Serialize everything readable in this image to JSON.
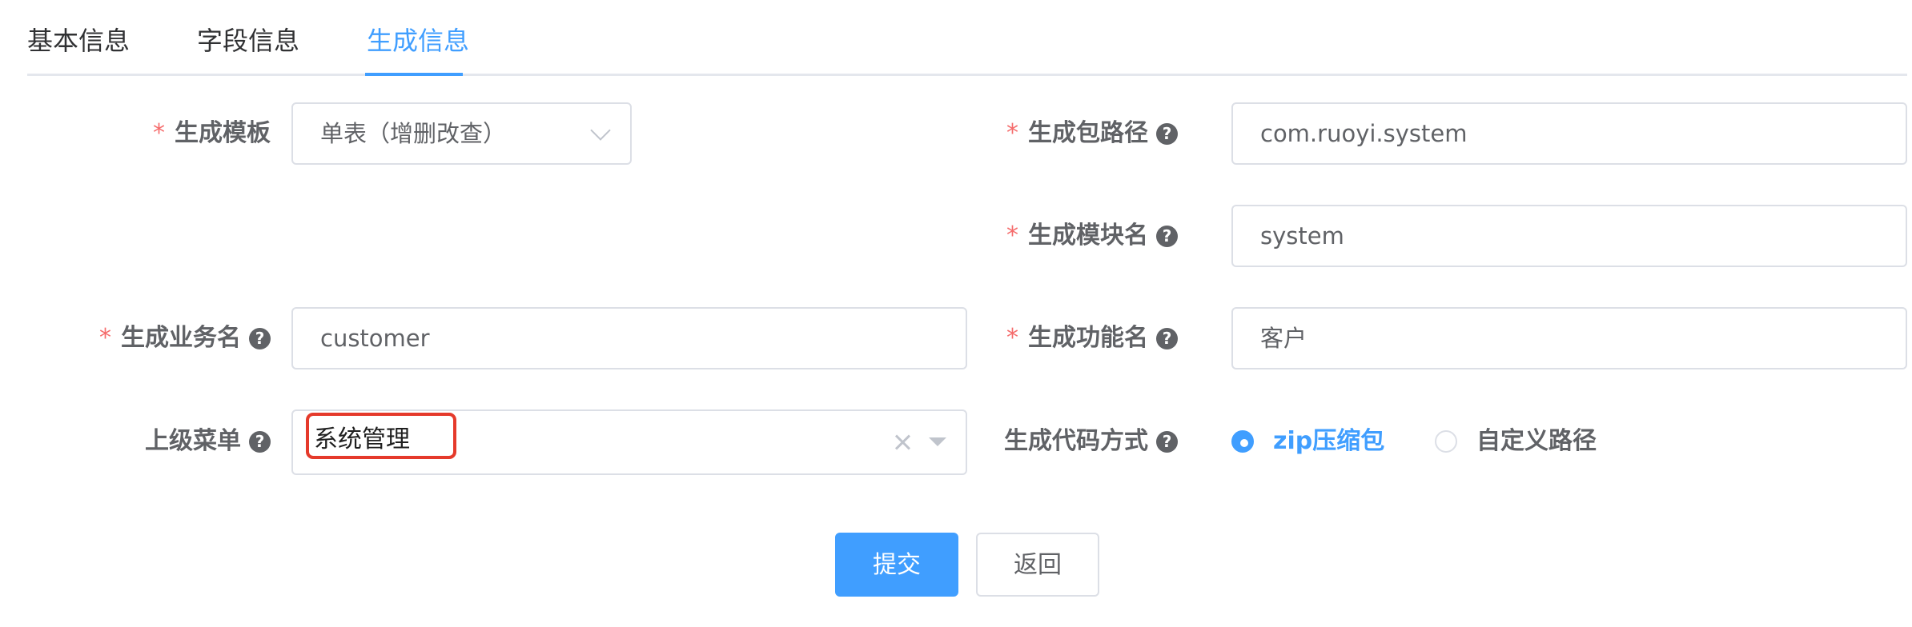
{
  "tabs": [
    {
      "label": "基本信息",
      "active": false
    },
    {
      "label": "字段信息",
      "active": false
    },
    {
      "label": "生成信息",
      "active": true
    }
  ],
  "form": {
    "tpl_category": {
      "label": "生成模板",
      "required": true,
      "value": "单表（增删改查）"
    },
    "package_name": {
      "label": "生成包路径",
      "required": true,
      "value": "com.ruoyi.system"
    },
    "module_name": {
      "label": "生成模块名",
      "required": true,
      "value": "system"
    },
    "business_name": {
      "label": "生成业务名",
      "required": true,
      "value": "customer"
    },
    "function_name": {
      "label": "生成功能名",
      "required": true,
      "value": "客户"
    },
    "parent_menu": {
      "label": "上级菜单",
      "required": false,
      "value": "系统管理"
    },
    "gen_type": {
      "label": "生成代码方式",
      "options": [
        {
          "label": "zip压缩包",
          "checked": true
        },
        {
          "label": "自定义路径",
          "checked": false
        }
      ]
    },
    "required_mark": "*",
    "help_icon_text": "?"
  },
  "actions": {
    "submit_label": "提交",
    "back_label": "返回"
  },
  "colors": {
    "primary": "#409eff",
    "required": "#f56c6c",
    "highlight": "#e53a2b"
  }
}
